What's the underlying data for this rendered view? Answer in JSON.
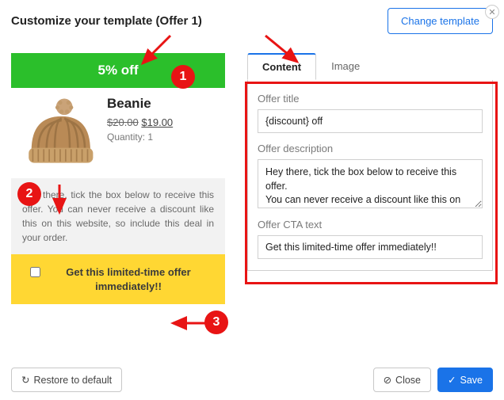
{
  "header": {
    "title": "Customize your template (Offer 1)",
    "change_btn": "Change template"
  },
  "preview": {
    "banner": "5% off",
    "product_name": "Beanie",
    "price_old": "$20.00",
    "price_new": "$19.00",
    "qty": "Quantity: 1",
    "description": "Hey there, tick the box below to receive this offer. You can never receive a discount like this on this website, so include this deal in your order.",
    "cta": "Get this limited-time offer immediately!!"
  },
  "tabs": {
    "content": "Content",
    "image": "Image"
  },
  "form": {
    "title_label": "Offer title",
    "title_value": "{discount} off",
    "desc_label": "Offer description",
    "desc_value": "Hey there, tick the box below to receive this offer.\nYou can never receive a discount like this on this website, so include this deal in your order.",
    "cta_label": "Offer CTA text",
    "cta_value": "Get this limited-time offer immediately!!"
  },
  "footer": {
    "restore": "Restore to default",
    "close": "Close",
    "save": "Save"
  },
  "annotations": {
    "n1": "1",
    "n2": "2",
    "n3": "3"
  }
}
